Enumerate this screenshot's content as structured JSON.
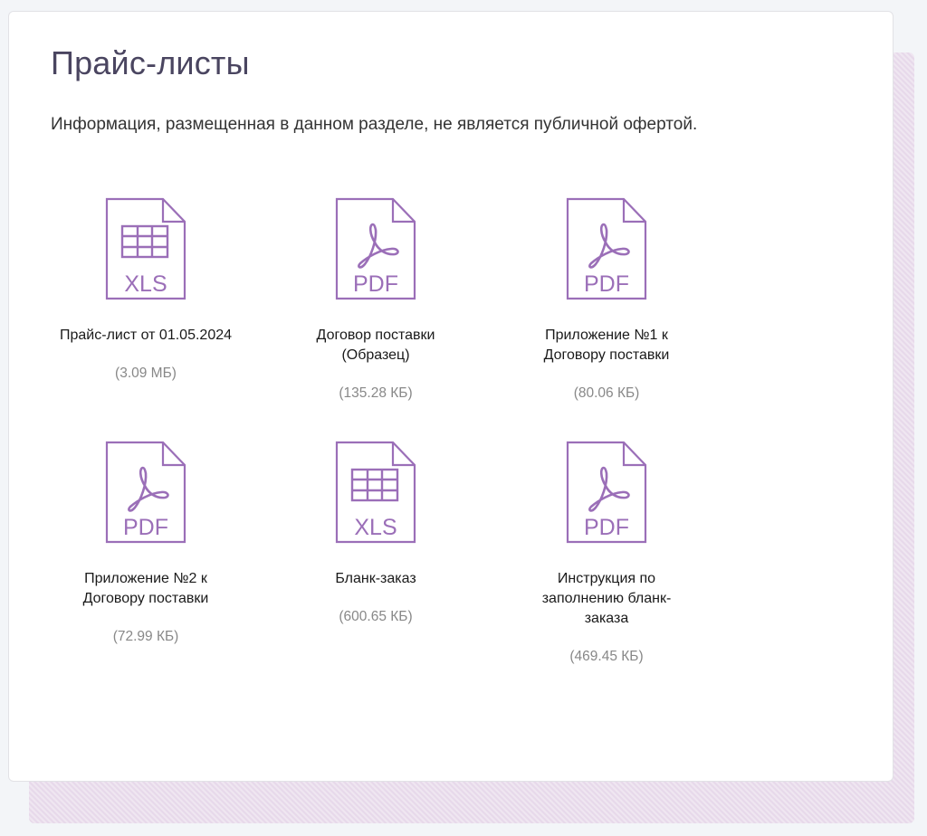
{
  "page": {
    "title": "Прайс-листы",
    "notice": "Информация, размещенная в данном разделе, не является публичной офертой."
  },
  "colors": {
    "icon_stroke": "#9b6fb8",
    "title": "#4a4560",
    "size_text": "#888888",
    "backdrop": "#e7d9ea"
  },
  "files": [
    {
      "type": "XLS",
      "icon": "spreadsheet-icon",
      "name": "Прайс-лист от 01.05.2024",
      "size": "(3.09 МБ)"
    },
    {
      "type": "PDF",
      "icon": "pdf-icon",
      "name": "Договор поставки (Образец)",
      "size": "(135.28 КБ)"
    },
    {
      "type": "PDF",
      "icon": "pdf-icon",
      "name": "Приложение №1 к Договору поставки",
      "size": "(80.06 КБ)"
    },
    {
      "type": "PDF",
      "icon": "pdf-icon",
      "name": "Приложение №2 к Договору поставки",
      "size": "(72.99 КБ)"
    },
    {
      "type": "XLS",
      "icon": "spreadsheet-icon",
      "name": "Бланк-заказ",
      "size": "(600.65 КБ)"
    },
    {
      "type": "PDF",
      "icon": "pdf-icon",
      "name": "Инструкция по заполнению бланк-заказа",
      "size": "(469.45 КБ)"
    }
  ]
}
